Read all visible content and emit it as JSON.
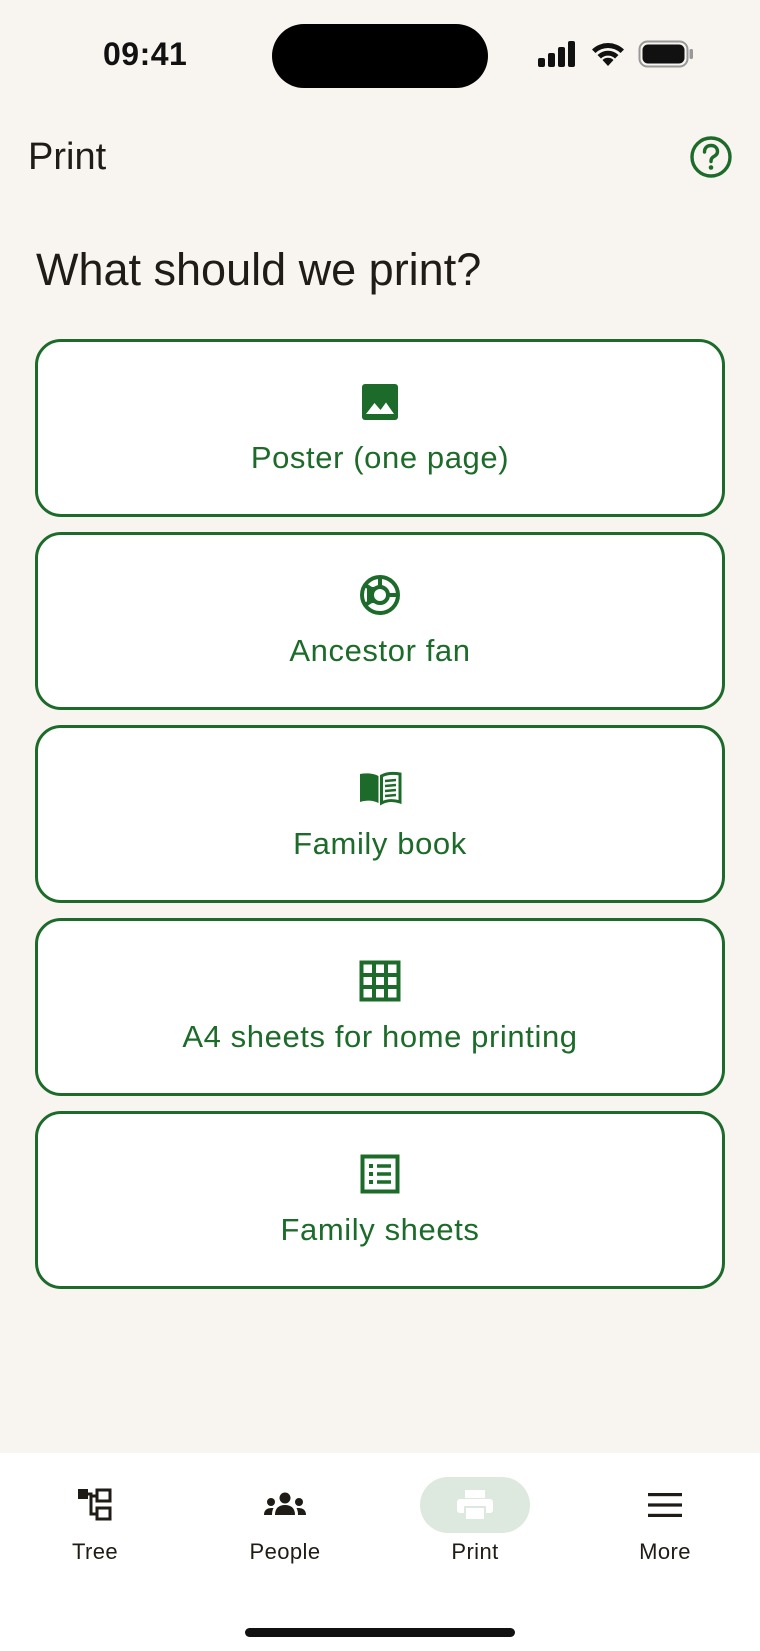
{
  "status_bar": {
    "time": "09:41",
    "signal_icon": "cellular-signal-icon",
    "wifi_icon": "wifi-icon",
    "battery_icon": "battery-icon"
  },
  "app_bar": {
    "title": "Print",
    "help_icon": "help-circle-icon"
  },
  "heading": "What should we print?",
  "options": [
    {
      "label": "Poster (one page)",
      "icon": "image-icon"
    },
    {
      "label": "Ancestor fan",
      "icon": "fan-chart-icon"
    },
    {
      "label": "Family book",
      "icon": "book-icon"
    },
    {
      "label": "A4 sheets for home printing",
      "icon": "grid-icon"
    },
    {
      "label": "Family sheets",
      "icon": "list-sheet-icon"
    }
  ],
  "bottom_nav": {
    "items": [
      {
        "label": "Tree",
        "icon": "tree-icon",
        "active": false
      },
      {
        "label": "People",
        "icon": "people-icon",
        "active": false
      },
      {
        "label": "Print",
        "icon": "printer-icon",
        "active": true
      },
      {
        "label": "More",
        "icon": "menu-icon",
        "active": false
      }
    ]
  },
  "colors": {
    "background": "#f8f4ef",
    "accent": "#1d6b2a",
    "card": "#ffffff",
    "active_pill": "#dde8df"
  }
}
